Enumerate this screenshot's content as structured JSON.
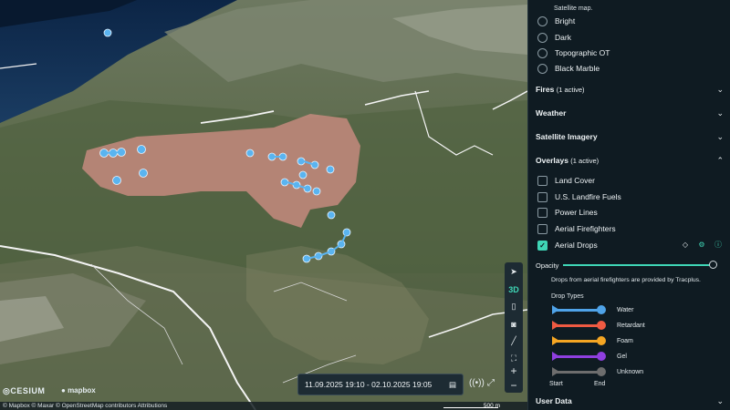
{
  "map": {
    "toolbar": {
      "compass_icon": "navigation-arrow-icon",
      "mode_label": "3D",
      "book_icon": "book-icon",
      "camera_icon": "camera-icon",
      "ruler_icon": "ruler-icon",
      "fullscreen_icon": "expand-icon"
    },
    "zoom": {
      "in_label": "+",
      "out_label": "−"
    },
    "time_range": {
      "text": "11.09.2025 19:10 - 02.10.2025 19:05"
    },
    "attribution": "© Mapbox © Maxar © OpenStreetMap contributors Attributions",
    "cesium_logo": "CESIUM",
    "mapbox_logo": "mapbox",
    "scale": "500 m",
    "colors": {
      "burn_area": "#c98b80",
      "drop_marker": "#5ab4f0",
      "road": "#f4f4f4"
    }
  },
  "sidebar": {
    "satellite_label": "Satellite map.",
    "basemaps": [
      {
        "label": "Bright"
      },
      {
        "label": "Dark"
      },
      {
        "label": "Topographic OT"
      },
      {
        "label": "Black Marble"
      }
    ],
    "sections": {
      "fires": {
        "label": "Fires",
        "sub": "(1 active)"
      },
      "weather": {
        "label": "Weather"
      },
      "satellite": {
        "label": "Satellite Imagery"
      },
      "overlays": {
        "label": "Overlays",
        "sub": "(1 active)"
      },
      "user_data": {
        "label": "User Data"
      }
    },
    "overlays": [
      {
        "label": "Land Cover",
        "checked": false
      },
      {
        "label": "U.S. Landfire Fuels",
        "checked": false
      },
      {
        "label": "Power Lines",
        "checked": false
      },
      {
        "label": "Aerial Firefighters",
        "checked": false
      },
      {
        "label": "Aerial Drops",
        "checked": true
      }
    ],
    "opacity_label": "Opacity",
    "opacity_value": 1.0,
    "drops_note": "Drops from aerial firefighters are provided by Tracplus.",
    "drop_types_label": "Drop Types",
    "drop_types": [
      {
        "label": "Water",
        "color": "#4fa3e8"
      },
      {
        "label": "Retardant",
        "color": "#f05a42"
      },
      {
        "label": "Foam",
        "color": "#f5a623"
      },
      {
        "label": "Gel",
        "color": "#8f3fe0"
      },
      {
        "label": "Unknown",
        "color": "#6d6d6d"
      }
    ],
    "start_label": "Start",
    "end_label": "End",
    "accent": "#3fd6b6"
  }
}
